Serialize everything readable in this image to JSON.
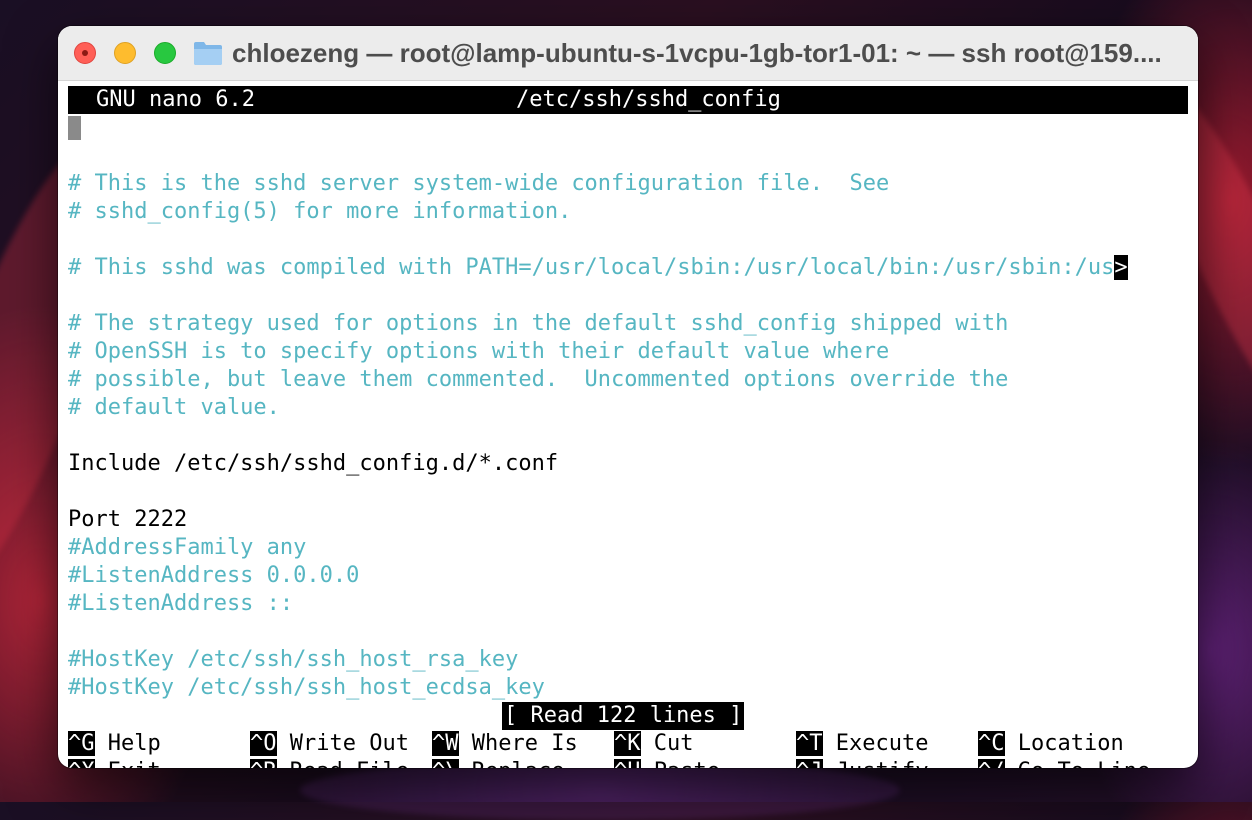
{
  "window": {
    "title": "chloezeng — root@lamp-ubuntu-s-1vcpu-1gb-tor1-01: ~ — ssh root@159...."
  },
  "nano": {
    "version": "GNU nano 6.2",
    "filename": "/etc/ssh/sshd_config",
    "lines": [
      {
        "text": "# This is the sshd server system-wide configuration file.  See",
        "type": "comment"
      },
      {
        "text": "# sshd_config(5) for more information.",
        "type": "comment"
      },
      {
        "text": "",
        "type": "blank"
      },
      {
        "text": "# This sshd was compiled with PATH=/usr/local/sbin:/usr/local/bin:/usr/sbin:/us",
        "type": "comment",
        "truncated_marker": ">"
      },
      {
        "text": "",
        "type": "blank"
      },
      {
        "text": "# The strategy used for options in the default sshd_config shipped with",
        "type": "comment"
      },
      {
        "text": "# OpenSSH is to specify options with their default value where",
        "type": "comment"
      },
      {
        "text": "# possible, but leave them commented.  Uncommented options override the",
        "type": "comment"
      },
      {
        "text": "# default value.",
        "type": "comment"
      },
      {
        "text": "",
        "type": "blank"
      },
      {
        "text": "Include /etc/ssh/sshd_config.d/*.conf",
        "type": "plain"
      },
      {
        "text": "",
        "type": "blank"
      },
      {
        "text": "Port 2222",
        "type": "plain"
      },
      {
        "text": "#AddressFamily any",
        "type": "comment"
      },
      {
        "text": "#ListenAddress 0.0.0.0",
        "type": "comment"
      },
      {
        "text": "#ListenAddress ::",
        "type": "comment"
      },
      {
        "text": "",
        "type": "blank"
      },
      {
        "text": "#HostKey /etc/ssh/ssh_host_rsa_key",
        "type": "comment"
      },
      {
        "text": "#HostKey /etc/ssh/ssh_host_ecdsa_key",
        "type": "comment"
      }
    ],
    "status_message": "[ Read 122 lines ]",
    "shortcuts": [
      {
        "key": "^G",
        "label": "Help",
        "name": "help"
      },
      {
        "key": "^O",
        "label": "Write Out",
        "name": "write-out"
      },
      {
        "key": "^W",
        "label": "Where Is",
        "name": "where-is"
      },
      {
        "key": "^K",
        "label": "Cut",
        "name": "cut"
      },
      {
        "key": "^T",
        "label": "Execute",
        "name": "execute"
      },
      {
        "key": "^C",
        "label": "Location",
        "name": "location"
      },
      {
        "key": "^X",
        "label": "Exit",
        "name": "exit"
      },
      {
        "key": "^R",
        "label": "Read File",
        "name": "read-file"
      },
      {
        "key": "^\\",
        "label": "Replace",
        "name": "replace"
      },
      {
        "key": "^U",
        "label": "Paste",
        "name": "paste"
      },
      {
        "key": "^J",
        "label": "Justify",
        "name": "justify"
      },
      {
        "key": "^/",
        "label": "Go To Line",
        "name": "go-to-line"
      }
    ]
  },
  "colors": {
    "comment": "#56b6c2",
    "header_bg": "#000000",
    "text": "#000000"
  }
}
